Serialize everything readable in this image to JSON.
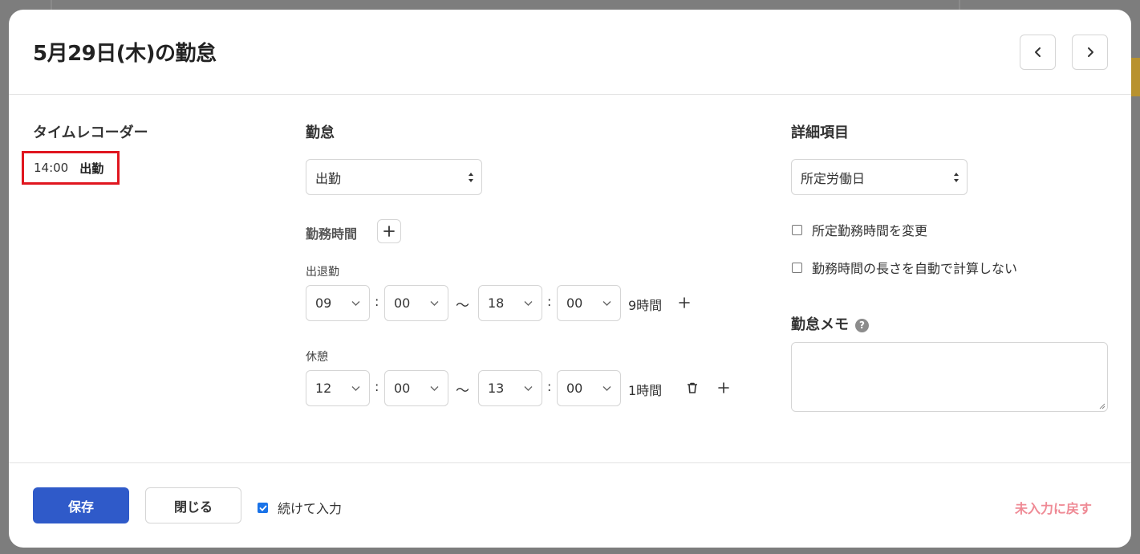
{
  "dialog": {
    "title": "5月29日(木)の勤怠"
  },
  "time_recorder": {
    "title": "タイムレコーダー",
    "entries": [
      {
        "time": "14:00",
        "type": "出勤"
      }
    ]
  },
  "attendance": {
    "title": "勤怠",
    "type_selected": "出勤",
    "work_time_label": "勤務時間",
    "shift": {
      "label": "出退勤",
      "start_hour": "09",
      "start_minute": "00",
      "end_hour": "18",
      "end_minute": "00",
      "duration": "9時間"
    },
    "break": {
      "label": "休憩",
      "start_hour": "12",
      "start_minute": "00",
      "end_hour": "13",
      "end_minute": "00",
      "duration": "1時間"
    },
    "separator": ":",
    "range_separator": "〜"
  },
  "details": {
    "title": "詳細項目",
    "day_type_selected": "所定労働日",
    "checkboxes": [
      {
        "label": "所定勤務時間を変更",
        "checked": false
      },
      {
        "label": "勤務時間の長さを自動で計算しない",
        "checked": false
      }
    ],
    "memo_title": "勤怠メモ",
    "memo_value": "",
    "help_glyph": "?"
  },
  "footer": {
    "save_label": "保存",
    "close_label": "閉じる",
    "continue_label": "続けて入力",
    "continue_checked": true,
    "reset_label": "未入力に戻す"
  },
  "colors": {
    "primary": "#2f5ac9",
    "highlight_border": "#e0161f",
    "reset_link": "#ef8a95",
    "checkbox_checked": "#1a73e8"
  },
  "icons": {
    "prev": "chevron-left-icon",
    "next": "chevron-right-icon",
    "add": "plus-icon",
    "delete": "trash-icon",
    "help": "question-circle-icon",
    "select_updown": "updown-arrows-icon",
    "select_dropdown": "chevron-down-icon"
  }
}
